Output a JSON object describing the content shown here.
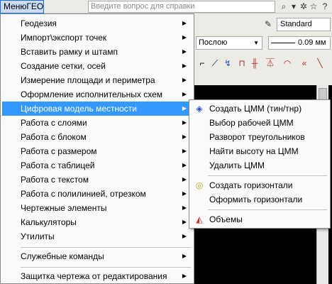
{
  "menubar": {
    "menu_label": "МенюГЕО",
    "help_placeholder": "Введите вопрос для справки"
  },
  "toolbar": {
    "style_value": "Standard",
    "layer_value": "Послою",
    "lineweight_value": "0.09 мм"
  },
  "main_menu": {
    "items": [
      {
        "label": "Геодезия"
      },
      {
        "label": "Импорт\\экспорт точек"
      },
      {
        "label": "Вставить рамку и штамп"
      },
      {
        "label": "Создание сетки, осей"
      },
      {
        "label": "Измерение площади и периметра"
      },
      {
        "label": "Оформление исполнительных схем"
      },
      {
        "label": "Цифровая модель местности"
      },
      {
        "label": "Работа с слоями"
      },
      {
        "label": "Работа с блоком"
      },
      {
        "label": "Работа с размером"
      },
      {
        "label": "Работа с таблицей"
      },
      {
        "label": "Работа с текстом"
      },
      {
        "label": "Работа с полилинией, отрезком"
      },
      {
        "label": "Чертежные элементы"
      },
      {
        "label": "Калькуляторы"
      },
      {
        "label": "Утилиты"
      },
      {
        "label": "Служебные команды"
      },
      {
        "label": "Защитка чертежа от редактирования"
      }
    ]
  },
  "sub_menu": {
    "items": [
      {
        "label": "Создать ЦММ (тин/тнр)",
        "icon": "grid-icon"
      },
      {
        "label": "Выбор рабочей ЦММ"
      },
      {
        "label": "Разворот треугольников"
      },
      {
        "label": "Найти высоту на ЦММ"
      },
      {
        "label": "Удалить ЦММ"
      },
      {
        "label": "Создать горизонтали",
        "icon": "contour-icon"
      },
      {
        "label": "Оформить горизонтали"
      },
      {
        "label": "Объемы",
        "icon": "volume-icon"
      }
    ]
  }
}
